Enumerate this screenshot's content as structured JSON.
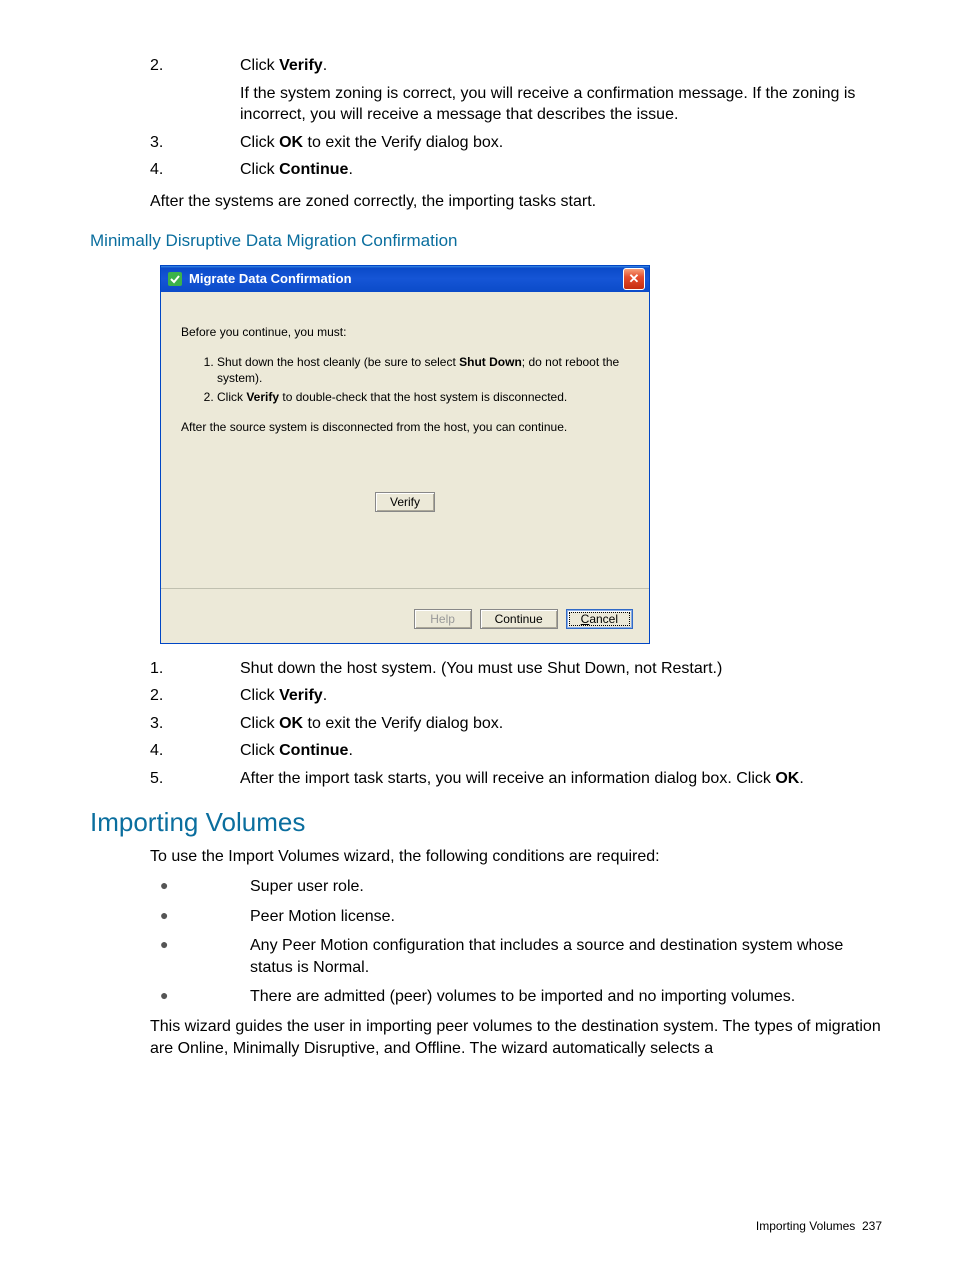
{
  "section1": {
    "items": [
      {
        "num": "2.",
        "pre": "Click ",
        "bold": "Verify",
        "post": ".",
        "sub": "If the system zoning is correct, you will receive a confirmation message. If the zoning is incorrect, you will receive a message that describes the issue."
      },
      {
        "num": "3.",
        "pre": "Click ",
        "bold": "OK",
        "post": " to exit the Verify dialog box."
      },
      {
        "num": "4.",
        "pre": "Click ",
        "bold": "Continue",
        "post": "."
      }
    ],
    "after": "After the systems are zoned correctly, the importing tasks start."
  },
  "subhead1": "Minimally Disruptive Data Migration Confirmation",
  "dialog": {
    "title": "Migrate Data Confirmation",
    "intro": "Before you continue, you must:",
    "steps": [
      {
        "pre": "Shut down the host cleanly (be sure to select ",
        "bold": "Shut Down",
        "post": "; do not reboot the system)."
      },
      {
        "pre": "Click ",
        "bold": "Verify",
        "post": " to double-check that the host system is disconnected."
      }
    ],
    "after": "After the source system is disconnected from the host, you can continue.",
    "verify_label": "Verify",
    "help_label": "Help",
    "continue_label": "Continue",
    "cancel_label": "Cancel"
  },
  "section2": {
    "items": [
      {
        "num": "1.",
        "text": "Shut down the host system. (You must use Shut Down, not Restart.)"
      },
      {
        "num": "2.",
        "pre": "Click ",
        "bold": "Verify",
        "post": "."
      },
      {
        "num": "3.",
        "pre": "Click ",
        "bold": "OK",
        "post": " to exit the Verify dialog box."
      },
      {
        "num": "4.",
        "pre": "Click ",
        "bold": "Continue",
        "post": "."
      },
      {
        "num": "5.",
        "pre": "After the import task starts, you will receive an information dialog box. Click ",
        "bold": "OK",
        "post": "."
      }
    ]
  },
  "heading2": "Importing Volumes",
  "intro2": "To use the Import Volumes wizard, the following conditions are required:",
  "bullets": [
    "Super user role.",
    "Peer Motion license.",
    "Any Peer Motion configuration that includes a source and destination system whose status is Normal.",
    "There are admitted (peer) volumes to be imported and no importing volumes."
  ],
  "outro2": "This wizard guides the user in importing peer volumes to the destination system. The types of migration are Online, Minimally Disruptive, and Offline. The wizard automatically selects a",
  "footer": {
    "label": "Importing Volumes",
    "page": "237"
  }
}
